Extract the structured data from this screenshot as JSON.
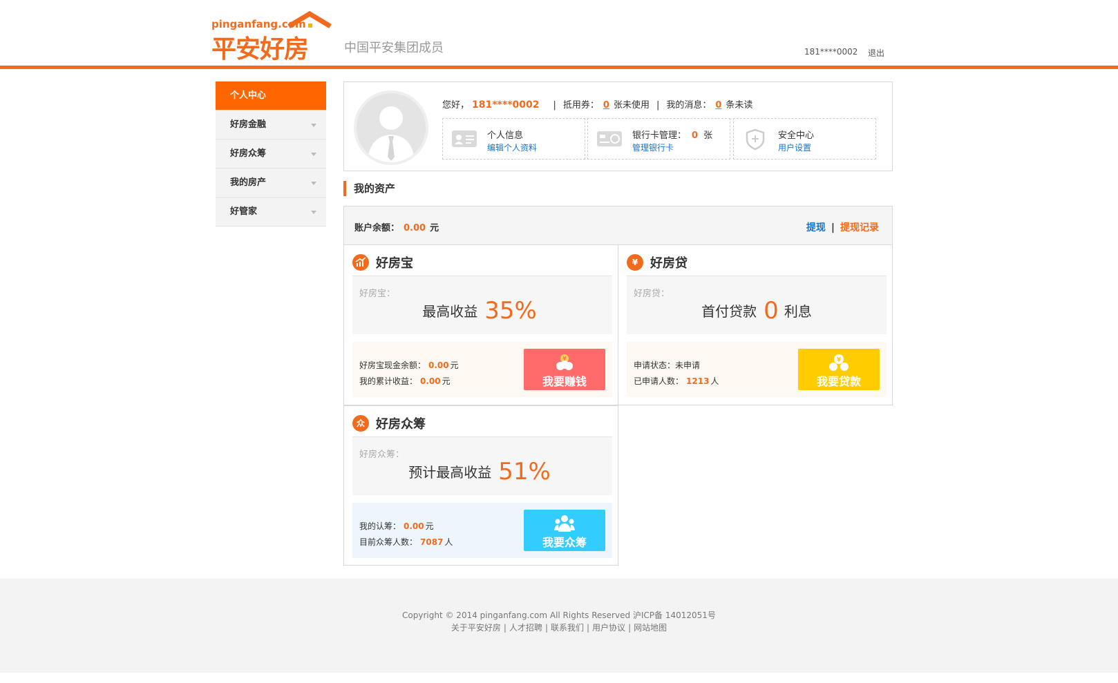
{
  "header": {
    "logo_url": "pinganfang.com",
    "logo_name": "平安好房",
    "slogan": "中国平安集团成员",
    "user_phone": "181****0002",
    "logout": "退出"
  },
  "sidebar": {
    "items": [
      {
        "label": "个人中心"
      },
      {
        "label": "好房金融"
      },
      {
        "label": "好房众筹"
      },
      {
        "label": "我的房产"
      },
      {
        "label": "好管家"
      }
    ]
  },
  "profile": {
    "hello": "您好，",
    "phone": "181****0002",
    "sep": "|",
    "voucher_label": "抵用券：",
    "voucher_count": "0",
    "voucher_unit": "张未使用",
    "msg_label": "我的消息：",
    "msg_count": "0",
    "msg_unit": "条未读",
    "cards": {
      "info_title": "个人信息",
      "info_link": "编辑个人资料",
      "bank_title": "银行卡管理：",
      "bank_count": "0",
      "bank_unit": "张",
      "bank_link": "管理银行卡",
      "safety_title": "安全中心",
      "safety_link": "用户设置"
    }
  },
  "assets": {
    "title": "我的资产",
    "balance_label": "账户余额：",
    "balance_value": "0.00",
    "balance_unit": "元",
    "withdraw": "提现",
    "divider": "|",
    "withdraw_record": "提现记录"
  },
  "products": {
    "bao": {
      "name": "好房宝",
      "sub": "好房宝：",
      "main_text": "最高收益",
      "main_value": "35%",
      "r1_label": "好房宝现金余额：",
      "r1_value": "0.00",
      "r1_unit": "元",
      "r2_label": "我的累计收益：",
      "r2_value": "0.00",
      "r2_unit": "元",
      "button": "我要赚钱",
      "button_color": "#ff6b6b",
      "info_bg": "#fdf8f1"
    },
    "dai": {
      "name": "好房贷",
      "sub": "好房贷：",
      "main_text": "首付贷款",
      "main_value": "0",
      "main_suffix": "利息",
      "r1_label": "申请状态：",
      "r1_value": "未申请",
      "r2_label": "已申请人数：",
      "r2_value": "1213",
      "r2_unit": "人",
      "button": "我要贷款",
      "button_color": "#ffcc00",
      "info_bg": "#fdf8f1"
    },
    "chou": {
      "name": "好房众筹",
      "icon_char": "众",
      "sub": "好房众筹：",
      "main_text": "预计最高收益",
      "main_value": "51%",
      "r1_label": "我的认筹：",
      "r1_value": "0.00",
      "r1_unit": "元",
      "r2_label": "目前众筹人数：",
      "r2_value": "7087",
      "r2_unit": "人",
      "button": "我要众筹",
      "button_color": "#33ccff",
      "info_bg": "#eef6fd"
    }
  },
  "footer": {
    "copyright": "Copyright © 2014 pinganfang.com All Rights Reserved  沪ICP备 14012051号",
    "links": [
      "关于平安好房",
      "人才招聘",
      "联系我们",
      "用户协议",
      "网站地图"
    ],
    "divider": "|"
  },
  "colors": {
    "accent": "#f26b1d",
    "link": "#1a74c7"
  }
}
